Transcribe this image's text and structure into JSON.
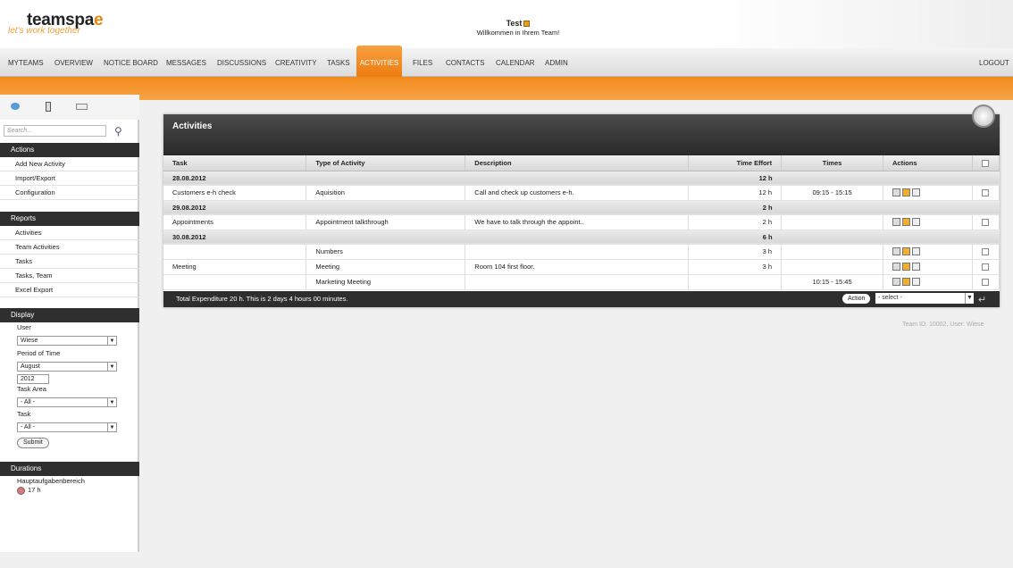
{
  "header": {
    "logo": "teamspa",
    "logo_end": "e",
    "tagline": "let's work together",
    "user": "Test",
    "welcome": "Willkommen in Ihrem Team!"
  },
  "nav": {
    "items": [
      "MYTEAMS",
      "OVERVIEW",
      "NOTICE BOARD",
      "MESSAGES",
      "DISCUSSIONS",
      "CREATIVITY",
      "TASKS",
      "ACTIVITIES",
      "FILES",
      "CONTACTS",
      "CALENDAR",
      "ADMIN"
    ],
    "logout": "LOGOUT",
    "active": "ACTIVITIES"
  },
  "sidebar": {
    "search_placeholder": "Search...",
    "actions_title": "Actions",
    "actions": [
      "Add New Activity",
      "Import/Export",
      "Configuration"
    ],
    "reports_title": "Reports",
    "reports": [
      "Activities",
      "Team Activities",
      "Tasks",
      "Tasks, Team",
      "Excel Export"
    ],
    "display_title": "Display",
    "user_label": "User",
    "user_value": "Wiese",
    "period_label": "Period of Time",
    "month_value": "August",
    "year_value": "2012",
    "taskarea_label": "Task Area",
    "taskarea_value": "- All -",
    "task_label": "Task",
    "task_value": "- All -",
    "submit": "Submit",
    "durations_title": "Durations",
    "durations_area": "Hauptaufgabenbereich",
    "durations_value": "17 h"
  },
  "main": {
    "title": "Activities",
    "columns": [
      "Task",
      "Type of Activity",
      "Description",
      "Time Effort",
      "Times",
      "Actions"
    ],
    "groups": [
      {
        "date": "28.08.2012",
        "total": "12 h",
        "rows": [
          {
            "task": "Customers e-h check",
            "type": "Aquisition",
            "desc": "Call and check up customers e-h.",
            "effort": "12 h",
            "times": "09:15 - 15:15"
          }
        ]
      },
      {
        "date": "29.08.2012",
        "total": "2 h",
        "rows": [
          {
            "task": "Appointments",
            "type": "Appointment talkthrough",
            "desc": "We have to talk through the appoint..",
            "effort": "2 h",
            "times": ""
          }
        ]
      },
      {
        "date": "30.08.2012",
        "total": "6 h",
        "rows": [
          {
            "task": "",
            "type": "Numbers",
            "desc": "",
            "effort": "3 h",
            "times": ""
          },
          {
            "task": "Meeting",
            "type": "Meeting",
            "desc": "Room 104 first floor.",
            "effort": "3 h",
            "times": ""
          },
          {
            "task": "",
            "type": "Marketing Meeting",
            "desc": "",
            "effort": "",
            "times": "10:15 - 15:45"
          }
        ]
      }
    ],
    "footer": "Total Expenditure 20 h. This is  2 days 4 hours 00 minutes.",
    "action_btn": "Action",
    "select_value": "- select -"
  },
  "team_id": "Team ID: 10002, User: Wiese",
  "colors": {
    "accent": "#ec7c10",
    "dark": "#2e2e2e"
  }
}
